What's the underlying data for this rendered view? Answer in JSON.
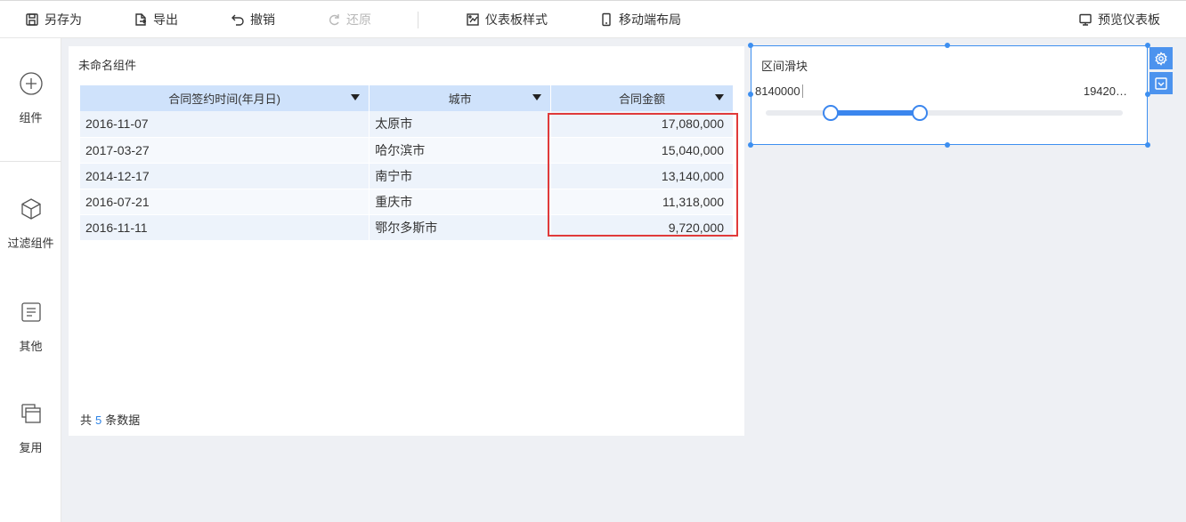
{
  "toolbar": {
    "save_as": "另存为",
    "export": "导出",
    "undo": "撤销",
    "redo": "还原",
    "dashboard_style": "仪表板样式",
    "mobile_layout": "移动端布局",
    "preview": "预览仪表板"
  },
  "sidebar": {
    "items": [
      {
        "label": "组件",
        "icon": "plus-circle-icon"
      },
      {
        "label": "过滤组件",
        "icon": "cube-icon"
      },
      {
        "label": "其他",
        "icon": "document-icon"
      },
      {
        "label": "复用",
        "icon": "copy-stack-icon"
      }
    ]
  },
  "table_widget": {
    "title": "未命名组件",
    "columns": [
      "合同签约时间(年月日)",
      "城市",
      "合同金额"
    ],
    "rows": [
      [
        "2016-11-07",
        "太原市",
        "17,080,000"
      ],
      [
        "2017-03-27",
        "哈尔滨市",
        "15,040,000"
      ],
      [
        "2014-12-17",
        "南宁市",
        "13,140,000"
      ],
      [
        "2016-07-21",
        "重庆市",
        "11,318,000"
      ],
      [
        "2016-11-11",
        "鄂尔多斯市",
        "9,720,000"
      ]
    ],
    "footer_prefix": "共",
    "footer_count": "5",
    "footer_suffix": "条数据"
  },
  "slider_widget": {
    "title": "区间滑块",
    "min_value": "8140000",
    "max_value": "19420…",
    "range_fraction": {
      "start": 0.18,
      "end": 0.43
    }
  },
  "colors": {
    "accent": "#3b86ee",
    "header_bg": "#cfe2fb",
    "highlight": "#e03a3a"
  }
}
